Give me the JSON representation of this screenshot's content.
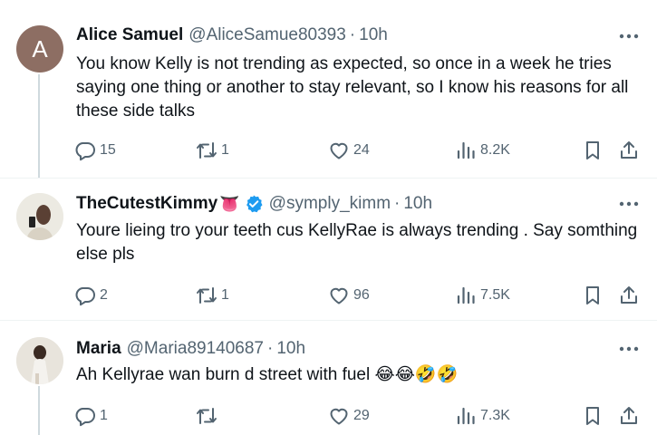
{
  "tweets": [
    {
      "name": "Alice Samuel",
      "handle": "@AliceSamue80393",
      "dot": "·",
      "time": "10h",
      "avatar_letter": "A",
      "text": "You know Kelly is not trending as expected, so once in a week he tries saying one thing or another to stay relevant, so I know his reasons for all these side talks",
      "replies": "15",
      "retweets": "1",
      "likes": "24",
      "views": "8.2K"
    },
    {
      "name": "TheCutestKimmy",
      "name_emoji": "👅",
      "handle": "@symply_kimm",
      "dot": "·",
      "time": "10h",
      "text": "Youre lieing tro your teeth cus KellyRae is always trending . Say somthing else pls",
      "replies": "2",
      "retweets": "1",
      "likes": "96",
      "views": "7.5K"
    },
    {
      "name": "Maria",
      "handle": "@Maria89140687",
      "dot": "·",
      "time": "10h",
      "text": "Ah Kellyrae wan burn d street with fuel 😂😂🤣🤣",
      "replies": "1",
      "retweets": "",
      "likes": "29",
      "views": "7.3K"
    }
  ],
  "colors": {
    "text": "#0f1419",
    "secondary": "#536471",
    "verified": "#1d9bf0",
    "thread_line": "#cfd9de",
    "avatar_bg": "#8d6e63"
  },
  "icons": [
    "more-icon",
    "reply-icon",
    "retweet-icon",
    "like-icon",
    "views-icon",
    "bookmark-icon",
    "share-icon",
    "verified-badge-icon"
  ]
}
